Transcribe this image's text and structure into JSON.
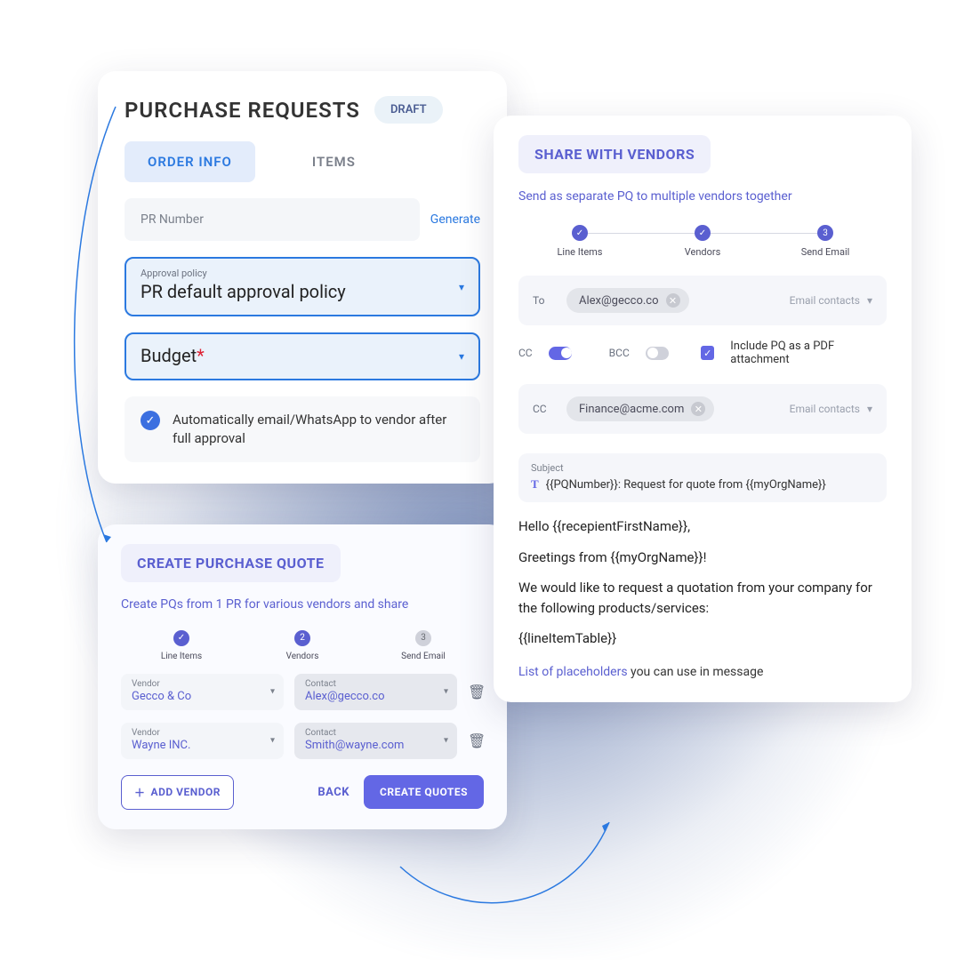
{
  "colors": {
    "accent": "#6367e5",
    "accent2": "#2b79e0"
  },
  "pr": {
    "title": "PURCHASE REQUESTS",
    "status": "DRAFT",
    "tabs": {
      "order_info": "ORDER INFO",
      "items": "ITEMS"
    },
    "pr_number_placeholder": "PR Number",
    "generate_link": "Generate",
    "approval_label": "Approval policy",
    "approval_value": "PR default approval policy",
    "budget_label": "Budget",
    "budget_required_mark": "*",
    "auto_email_text": "Automatically email/WhatsApp to vendor after full approval"
  },
  "pq": {
    "title": "CREATE PURCHASE QUOTE",
    "subtitle": "Create PQs from 1 PR for various vendors and share",
    "steps": [
      "Line Items",
      "Vendors",
      "Send Email"
    ],
    "step_state": [
      "done",
      "current",
      "todo"
    ],
    "vendor_label": "Vendor",
    "contact_label": "Contact",
    "rows": [
      {
        "vendor": "Gecco & Co",
        "contact": "Alex@gecco.co"
      },
      {
        "vendor": "Wayne INC.",
        "contact": "Smith@wayne.com"
      }
    ],
    "add_label": "ADD VENDOR",
    "back_label": "BACK",
    "create_label": "CREATE QUOTES"
  },
  "share": {
    "title": "SHARE WITH VENDORS",
    "subtitle": "Send as separate PQ to multiple vendors together",
    "steps": [
      "Line Items",
      "Vendors",
      "Send Email"
    ],
    "step_numbers": [
      "",
      "",
      "3"
    ],
    "step_state": [
      "done",
      "done",
      "current"
    ],
    "to_label": "To",
    "to_chips": [
      "Alex@gecco.co"
    ],
    "contacts_label": "Email contacts",
    "cc_label": "CC",
    "bcc_label": "BCC",
    "cc_on": true,
    "bcc_on": false,
    "pdf_label": "Include PQ as a PDF attachment",
    "cc_chips": [
      "Finance@acme.com"
    ],
    "subject_label": "Subject",
    "subject_value": "{{PQNumber}}: Request for quote from {{myOrgName}}",
    "body": [
      "Hello {{recepientFirstName}},",
      "Greetings from {{myOrgName}}!",
      "We would like to request a quotation from your company for the following products/services:",
      "{{lineItemTable}}"
    ],
    "placeholders_link": "List of placeholders",
    "placeholders_rest": " you can use in message"
  }
}
